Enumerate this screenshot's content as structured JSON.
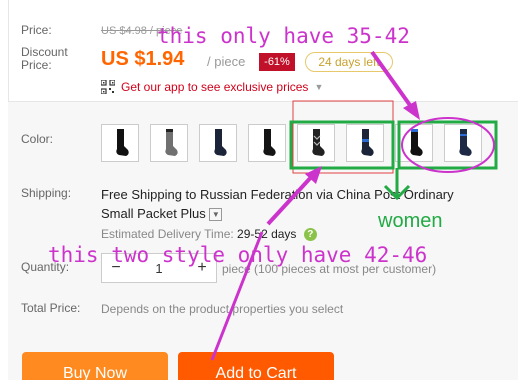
{
  "price": {
    "price_label": "Price:",
    "original": "US $4.98 / piece",
    "discount_label_line1": "Discount",
    "discount_label_line2": "Price:",
    "sale": "US $1.94",
    "per_piece": "/ piece",
    "discount_badge": "-61%",
    "days_left": "24 days left",
    "app_promo": "Get our app to see exclusive prices"
  },
  "color": {
    "label": "Color:",
    "swatches": [
      {
        "name": "black-sock"
      },
      {
        "name": "gray-sock"
      },
      {
        "name": "navy-sock"
      },
      {
        "name": "black-sock-2"
      },
      {
        "name": "argyle-sock"
      },
      {
        "name": "navy-blue-sock"
      },
      {
        "name": "black-blue-sock"
      },
      {
        "name": "navy-sock-2"
      }
    ],
    "colors": {
      "black": "#111111",
      "gray": "#707070",
      "navy": "#1b2438",
      "blue": "#2a6bd1"
    }
  },
  "shipping": {
    "label": "Shipping:",
    "text_line1": "Free Shipping to Russian Federation via China Post Ordinary",
    "text_line2": "Small Packet Plus",
    "delivery_label": "Estimated Delivery Time:",
    "delivery_days": "29-52 days"
  },
  "quantity": {
    "label": "Quantity:",
    "minus": "−",
    "value": "1",
    "plus": "+",
    "note": "piece (100 pieces at most per customer)"
  },
  "total": {
    "label": "Total Price:",
    "note": "Depends on the product properties you select"
  },
  "buttons": {
    "buy_now": "Buy Now",
    "add_to_cart": "Add to Cart"
  },
  "annotations": {
    "top": "this only have 35-42",
    "women": "women",
    "bottom": "this two style only have 42-46",
    "purple": "#cc33cc",
    "green": "#22aa44"
  }
}
